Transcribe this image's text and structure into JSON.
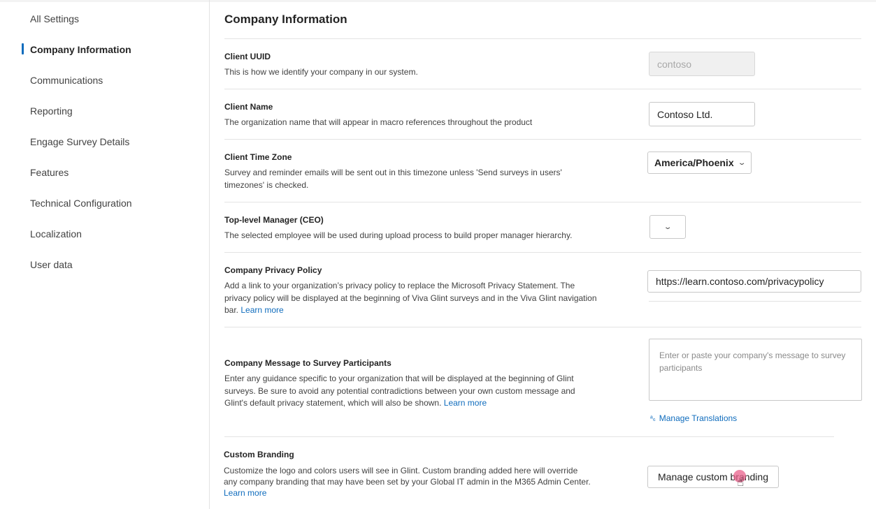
{
  "sidebar": {
    "items": [
      {
        "label": "All Settings"
      },
      {
        "label": "Company Information",
        "active": true
      },
      {
        "label": "Communications"
      },
      {
        "label": "Reporting"
      },
      {
        "label": "Engage Survey Details"
      },
      {
        "label": "Features"
      },
      {
        "label": "Technical Configuration"
      },
      {
        "label": "Localization"
      },
      {
        "label": "User data"
      }
    ]
  },
  "main": {
    "title": "Company Information",
    "client_uuid": {
      "title": "Client UUID",
      "description": "This is how we identify your company in our system.",
      "value": "contoso"
    },
    "client_name": {
      "title": "Client Name",
      "description": "The organization name that will appear in macro references throughout the product",
      "value": "Contoso Ltd."
    },
    "time_zone": {
      "title": "Client Time Zone",
      "description_line1": "Survey and reminder emails will be sent out in this timezone unless 'Send surveys in users'",
      "description_line2": "timezones' is checked.",
      "value": "America/Phoenix"
    },
    "ceo": {
      "title": "Top-level Manager (CEO)",
      "description": "The selected employee will be used during upload process to build proper manager hierarchy.",
      "value": ""
    },
    "privacy": {
      "title": "Company Privacy Policy",
      "description_line1": "Add a link to your organization’s privacy policy to replace the Microsoft Privacy Statement. The",
      "description_line2": "privacy policy will be displayed at the beginning of Viva Glint surveys and in the Viva Glint navigation",
      "description_line3": "bar.",
      "learn_more": "Learn more",
      "value": "https://learn.contoso.com/privacypolicy"
    },
    "message": {
      "title": "Company Message to Survey Participants",
      "description_line1": "Enter any guidance specific to your organization that will be displayed at the beginning of Glint",
      "description_line2": "surveys. Be sure to avoid any potential contradictions between your own custom message and",
      "description_line3": "Glint's default privacy statement, which will also be shown.",
      "learn_more": "Learn more",
      "placeholder": "Enter or paste your company's message to survey participants",
      "manage_translations": "Manage Translations"
    },
    "branding": {
      "title": "Custom Branding",
      "description_line1": "Customize the logo and colors users will see in Glint. Custom branding added here will override",
      "description_line2": "any company branding that may have been set by your Global IT admin in the M365 Admin Center.",
      "learn_more": "Learn more",
      "button": "Manage custom branding"
    }
  },
  "icons": {
    "dropdown": "chevron-down-icon",
    "translate": "translate-icon",
    "cursor": "hand-pointer-icon"
  },
  "colors": {
    "accent": "#0f6cbd",
    "cursor_highlight": "#e9618c"
  }
}
